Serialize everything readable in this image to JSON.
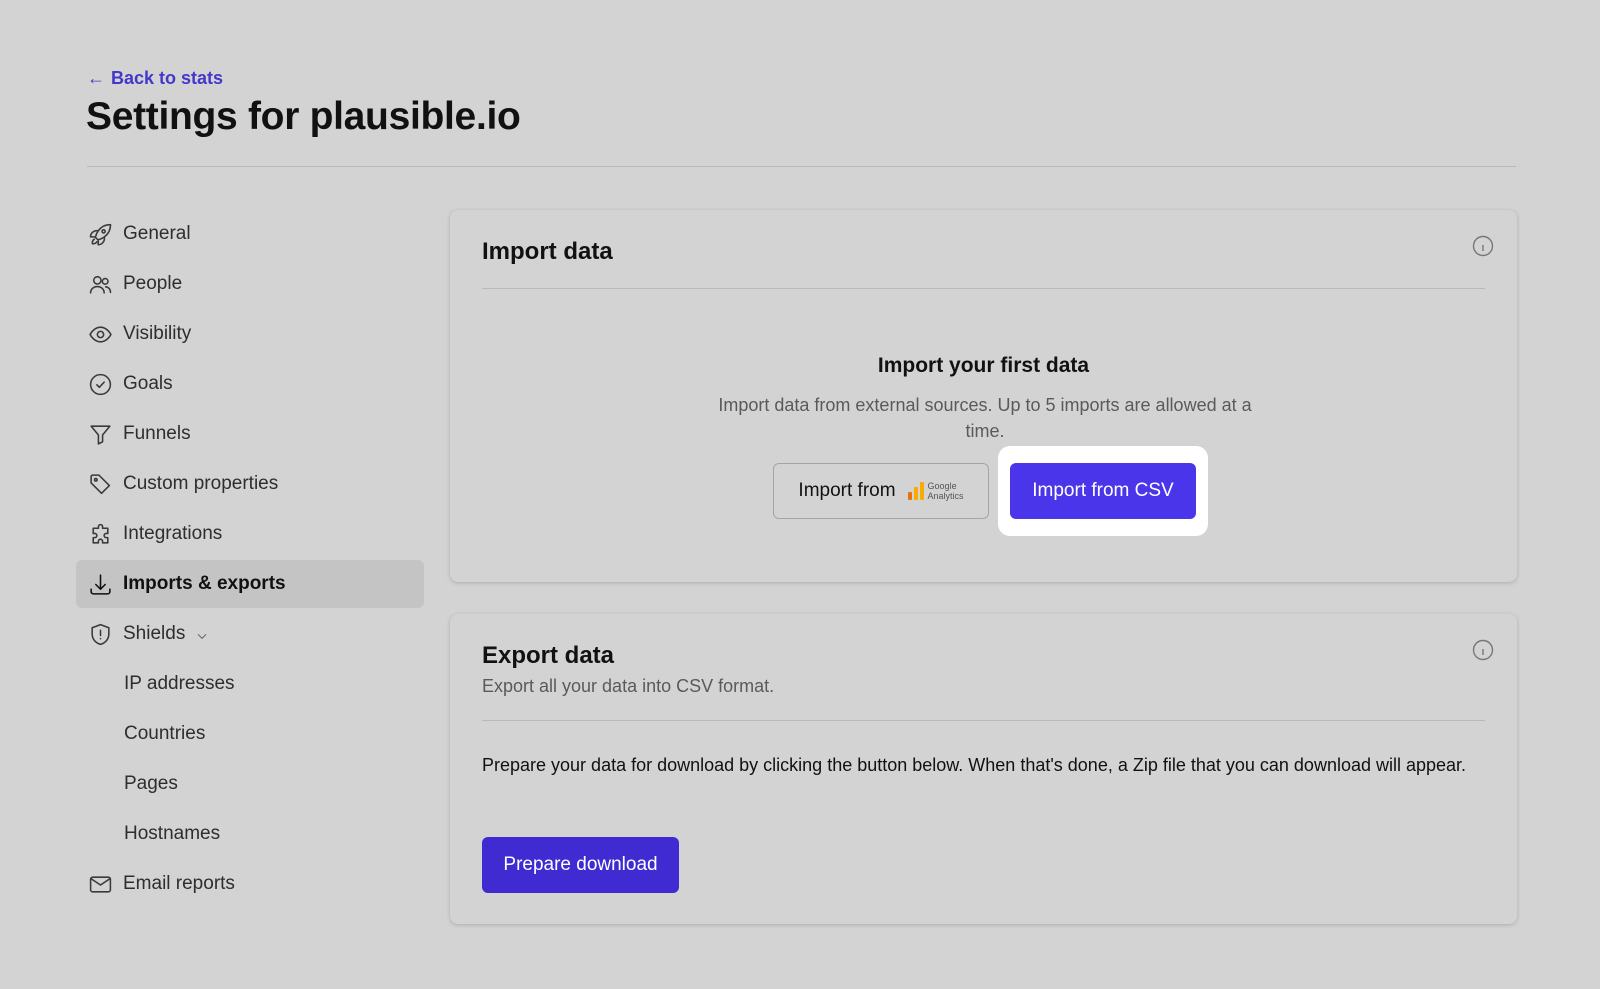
{
  "header": {
    "back_link": "Back to stats",
    "title": "Settings for plausible.io"
  },
  "sidebar": {
    "items": [
      {
        "label": "General",
        "icon": "rocket-icon"
      },
      {
        "label": "People",
        "icon": "people-icon"
      },
      {
        "label": "Visibility",
        "icon": "eye-icon"
      },
      {
        "label": "Goals",
        "icon": "check-circle-icon"
      },
      {
        "label": "Funnels",
        "icon": "funnel-icon"
      },
      {
        "label": "Custom properties",
        "icon": "tag-icon"
      },
      {
        "label": "Integrations",
        "icon": "puzzle-icon"
      },
      {
        "label": "Imports & exports",
        "icon": "download-icon",
        "active": true
      },
      {
        "label": "Shields",
        "icon": "shield-icon",
        "expanded": true
      },
      {
        "label": "IP addresses"
      },
      {
        "label": "Countries"
      },
      {
        "label": "Pages"
      },
      {
        "label": "Hostnames"
      },
      {
        "label": "Email reports",
        "icon": "envelope-icon"
      }
    ]
  },
  "import_card": {
    "title": "Import data",
    "heading": "Import your first data",
    "description": "Import data from external sources. Up to 5 imports are allowed at a time.",
    "ga_button_label": "Import from",
    "ga_logo_line1": "Google",
    "ga_logo_line2": "Analytics",
    "csv_button_label": "Import from CSV"
  },
  "export_card": {
    "title": "Export data",
    "subtitle": "Export all your data into CSV format.",
    "body": "Prepare your data for download by clicking the button below. When that's done, a Zip file that you can download will appear.",
    "button_label": "Prepare download"
  },
  "colors": {
    "accent": "#4b35ea",
    "link": "#4338ca",
    "background": "#d3d3d3"
  }
}
